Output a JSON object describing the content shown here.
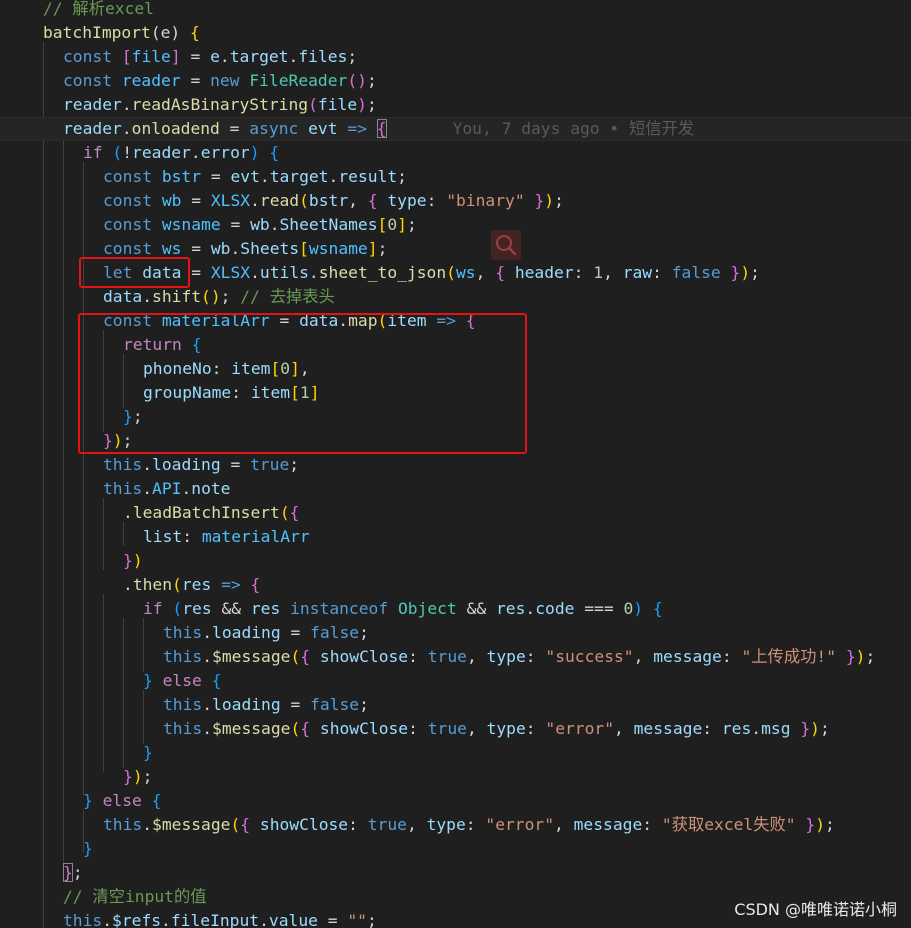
{
  "blame": {
    "text": "You, 7 days ago • 短信开发"
  },
  "watermark": {
    "text": "CSDN @唯唯诺诺小桐"
  },
  "icons": {
    "search_overlay": "search-icon"
  },
  "highlight_color": "#e51414",
  "lines": {
    "l0": [
      "// 解析excel"
    ],
    "l1": [
      "batchImport",
      "(e) ",
      "{"
    ],
    "l2": [
      "const",
      " ",
      "[",
      "file",
      "]",
      " = ",
      "e",
      ".",
      "target",
      ".",
      "files",
      ";"
    ],
    "l3": [
      "const",
      " ",
      "reader",
      " = ",
      "new",
      " ",
      "FileReader",
      "(",
      ")",
      ";"
    ],
    "l4": [
      "reader",
      ".",
      "readAsBinaryString",
      "(",
      "file",
      ")",
      ";"
    ],
    "l5": [
      "reader",
      ".",
      "onloadend",
      " = ",
      "async",
      " ",
      "evt",
      " => ",
      "{"
    ],
    "l6": [
      "if",
      " ",
      "(",
      "!",
      "reader",
      ".",
      "error",
      ") ",
      "{"
    ],
    "l7": [
      "const",
      " ",
      "bstr",
      " = ",
      "evt",
      ".",
      "target",
      ".",
      "result",
      ";"
    ],
    "l8": [
      "const",
      " ",
      "wb",
      " = ",
      "XLSX",
      ".",
      "read",
      "(",
      "bstr",
      ", ",
      "{",
      " ",
      "type",
      ": ",
      "\"binary\"",
      " ",
      "}",
      ")",
      ";"
    ],
    "l9": [
      "const",
      " ",
      "wsname",
      " = ",
      "wb",
      ".",
      "SheetNames",
      "[",
      "0",
      "]",
      ";"
    ],
    "l10": [
      "const",
      " ",
      "ws",
      " = ",
      "wb",
      ".",
      "Sheets",
      "[",
      "wsname",
      "]",
      ";"
    ],
    "l11": [
      "let",
      " ",
      "data",
      " = ",
      "XLSX",
      ".",
      "utils",
      ".",
      "sheet_to_json",
      "(",
      "ws",
      ", ",
      "{",
      " ",
      "header",
      ": ",
      "1",
      ", ",
      "raw",
      ": ",
      "false",
      " ",
      "}",
      ")",
      ";"
    ],
    "l12": [
      "data",
      ".",
      "shift",
      "(",
      ")",
      "; ",
      "// 去掉表头"
    ],
    "l13": [
      "const",
      " ",
      "materialArr",
      " = ",
      "data",
      ".",
      "map",
      "(",
      "item",
      " => ",
      "{"
    ],
    "l14": [
      "return",
      " ",
      "{"
    ],
    "l15": [
      "phoneNo",
      ": ",
      "item",
      "[",
      "0",
      "]",
      ","
    ],
    "l16": [
      "groupName",
      ": ",
      "item",
      "[",
      "1",
      "]"
    ],
    "l17": [
      "}",
      ";"
    ],
    "l18": [
      "}",
      ")",
      ";"
    ],
    "l19": [
      "this",
      ".",
      "loading",
      " = ",
      "true",
      ";"
    ],
    "l20": [
      "this",
      ".",
      "API",
      ".",
      "note"
    ],
    "l21": [
      ".",
      "leadBatchInsert",
      "(",
      "{"
    ],
    "l22": [
      "list",
      ": ",
      "materialArr"
    ],
    "l23": [
      "}",
      ")"
    ],
    "l24": [
      ".",
      "then",
      "(",
      "res",
      " => ",
      "{"
    ],
    "l25": [
      "if",
      " ",
      "(",
      "res",
      " && ",
      "res",
      " ",
      "instanceof",
      " ",
      "Object",
      " && ",
      "res",
      ".",
      "code",
      " === ",
      "0",
      ") ",
      "{"
    ],
    "l26": [
      "this",
      ".",
      "loading",
      " = ",
      "false",
      ";"
    ],
    "l27": [
      "this",
      ".",
      "$message",
      "(",
      "{",
      " ",
      "showClose",
      ": ",
      "true",
      ", ",
      "type",
      ": ",
      "\"success\"",
      ", ",
      "message",
      ": ",
      "\"上传成功!\"",
      " ",
      "}",
      ")",
      ";"
    ],
    "l28": [
      "}",
      " ",
      "else",
      " ",
      "{"
    ],
    "l29": [
      "this",
      ".",
      "loading",
      " = ",
      "false",
      ";"
    ],
    "l30": [
      "this",
      ".",
      "$message",
      "(",
      "{",
      " ",
      "showClose",
      ": ",
      "true",
      ", ",
      "type",
      ": ",
      "\"error\"",
      ", ",
      "message",
      ": ",
      "res",
      ".",
      "msg",
      " ",
      "}",
      ")",
      ";"
    ],
    "l31": [
      "}"
    ],
    "l32": [
      "}",
      ")",
      ";"
    ],
    "l33": [
      "}",
      " ",
      "else",
      " ",
      "{"
    ],
    "l34": [
      "this",
      ".",
      "$message",
      "(",
      "{",
      " ",
      "showClose",
      ": ",
      "true",
      ", ",
      "type",
      ": ",
      "\"error\"",
      ", ",
      "message",
      ": ",
      "\"获取excel失败\"",
      " ",
      "}",
      ")",
      ";"
    ],
    "l35": [
      "}"
    ],
    "l36": [
      "}",
      ";"
    ],
    "l37": [
      "// 清空input的值"
    ],
    "l38": [
      "this",
      ".",
      "$refs",
      ".",
      "fileInput",
      ".",
      "value",
      " = ",
      "\"\"",
      ";"
    ]
  }
}
